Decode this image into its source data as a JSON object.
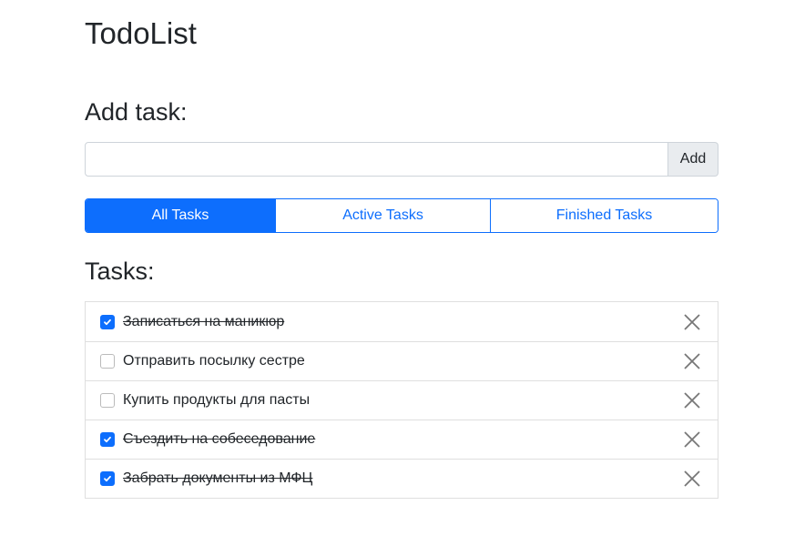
{
  "app_title": "TodoList",
  "add_section": {
    "heading": "Add task:",
    "input_value": "",
    "input_placeholder": "",
    "add_label": "Add"
  },
  "filters": [
    {
      "label": "All Tasks",
      "active": true
    },
    {
      "label": "Active Tasks",
      "active": false
    },
    {
      "label": "Finished Tasks",
      "active": false
    }
  ],
  "tasks_heading": "Tasks:",
  "tasks": [
    {
      "text": "Записаться на маникюр",
      "done": true
    },
    {
      "text": "Отправить посылку сестре",
      "done": false
    },
    {
      "text": "Купить продукты для пасты",
      "done": false
    },
    {
      "text": "Съездить на собеседование",
      "done": true
    },
    {
      "text": "Забрать документы из МФЦ",
      "done": true
    }
  ],
  "colors": {
    "accent": "#0d6efd"
  }
}
